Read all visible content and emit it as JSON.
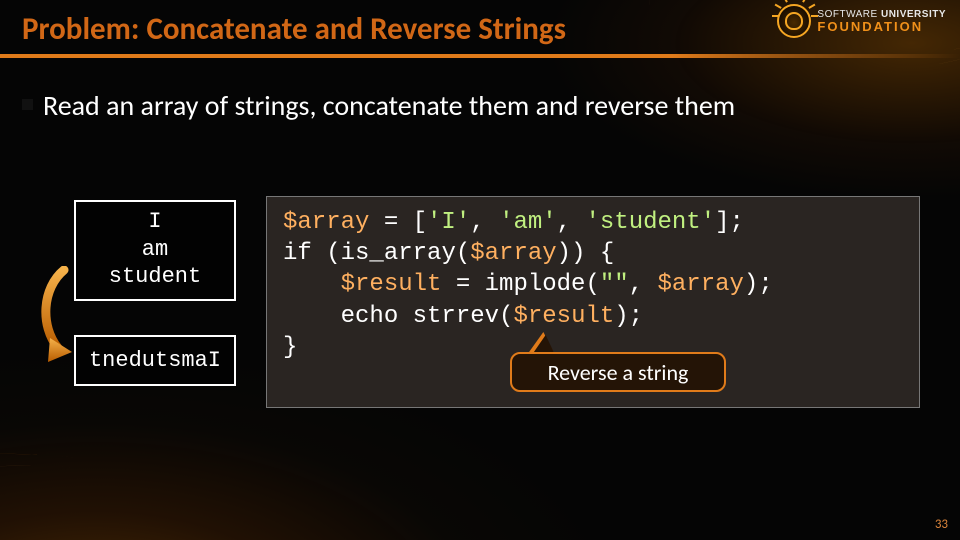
{
  "title": "Problem: Concatenate and Reverse Strings",
  "logo": {
    "line1_a": "SOFTWARE ",
    "line1_b": "UNIVERSITY",
    "line2": "FOUNDATION"
  },
  "bullet": "Read an array of strings, concatenate them and reverse them",
  "io": {
    "input_lines": [
      "I",
      "am",
      "student"
    ],
    "output": "tnedutsmaI"
  },
  "code": {
    "l1a": "$array",
    "l1b": " = [",
    "l1c": "'I'",
    "l1d": ", ",
    "l1e": "'am'",
    "l1f": ", ",
    "l1g": "'student'",
    "l1h": "];",
    "l2a": "if ",
    "l2b": "(is_array(",
    "l2c": "$array",
    "l2d": ")) {",
    "l3a": "    ",
    "l3b": "$result",
    "l3c": " = implode(",
    "l3d": "\"\"",
    "l3e": ", ",
    "l3f": "$array",
    "l3g": ");",
    "l4a": "    echo ",
    "l4b": "strrev(",
    "l4c": "$result",
    "l4d": ");",
    "l5": "}"
  },
  "callout": "Reverse a string",
  "page_number": "33"
}
